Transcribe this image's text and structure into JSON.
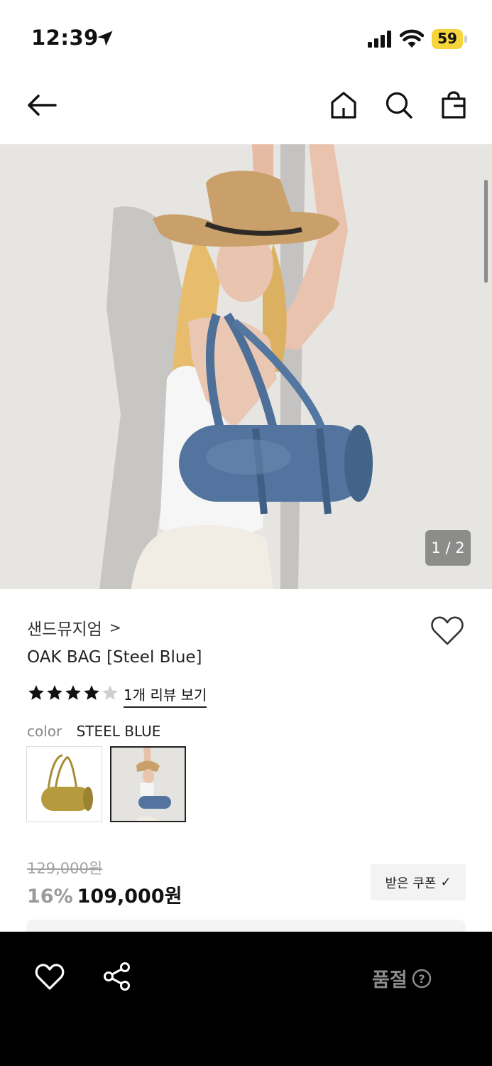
{
  "status_bar": {
    "time": "12:39",
    "battery": "59",
    "icons": [
      "location-arrow-icon",
      "cellular-signal-icon",
      "wifi-icon",
      "battery-icon"
    ]
  },
  "nav": {
    "icons": [
      "back-arrow-icon",
      "home-icon",
      "search-icon",
      "shopping-bag-icon"
    ]
  },
  "gallery": {
    "current": 1,
    "total": 2,
    "pager_text": "1 / 2"
  },
  "product": {
    "brand": "샌드뮤지엄",
    "brand_chevron": ">",
    "name": "OAK BAG [Steel Blue]",
    "rating": 4,
    "rating_max": 5,
    "review_link": "1개 리뷰 보기",
    "color_label": "color",
    "color_value": "STEEL BLUE",
    "color_options": [
      {
        "name": "oak-yellow",
        "selected": false,
        "color": "#b59a3e"
      },
      {
        "name": "steel-blue",
        "selected": true,
        "color": "#4f7099"
      }
    ],
    "original_price": "129,000원",
    "discount": "16%",
    "price": "109,000원",
    "coupon_label": "받은 쿠폰",
    "coupon_check": "✓"
  },
  "bottom_bar": {
    "status": "품절",
    "help_symbol": "?",
    "icons": [
      "heart-icon",
      "share-icon",
      "help-circle-icon"
    ]
  },
  "colors": {
    "star": "#111111",
    "star_empty": "#cfcfcf",
    "bottom_bar_bg": "#000000",
    "soldout_text": "#8d8d8d",
    "battery": "#f6d43b"
  }
}
